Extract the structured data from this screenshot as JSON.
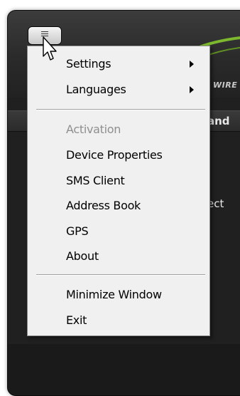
{
  "app": {
    "brand_text": "WIRE",
    "background_text_top": "and",
    "background_text_mid": "ect"
  },
  "menu": {
    "items": [
      {
        "label": "Settings",
        "has_submenu": true,
        "enabled": true
      },
      {
        "label": "Languages",
        "has_submenu": true,
        "enabled": true
      },
      {
        "label": "Activation",
        "has_submenu": false,
        "enabled": false
      },
      {
        "label": "Device Properties",
        "has_submenu": false,
        "enabled": true
      },
      {
        "label": "SMS Client",
        "has_submenu": false,
        "enabled": true
      },
      {
        "label": "Address Book",
        "has_submenu": false,
        "enabled": true
      },
      {
        "label": "GPS",
        "has_submenu": false,
        "enabled": true
      },
      {
        "label": "About",
        "has_submenu": false,
        "enabled": true
      },
      {
        "label": "Minimize Window",
        "has_submenu": false,
        "enabled": true
      },
      {
        "label": "Exit",
        "has_submenu": false,
        "enabled": true
      }
    ]
  },
  "icons": {
    "menu_button": "hamburger-icon",
    "submenu_arrow": "chevron-right-icon",
    "pointer": "mouse-cursor-icon"
  },
  "colors": {
    "app_background": "#202020",
    "menu_background": "#f0f0f0",
    "disabled_text": "#8f8f8f",
    "swoosh": "#7db82e"
  }
}
